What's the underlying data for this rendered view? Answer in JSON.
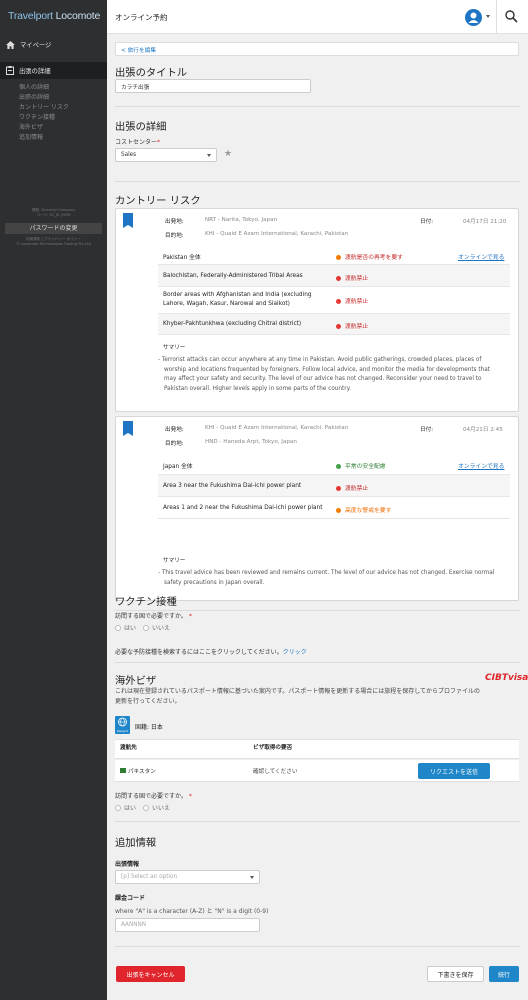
{
  "sidebar": {
    "logo_a": "Travelport",
    "logo_b": "Locomote",
    "home": "マイページ",
    "section": "出張の詳細",
    "subitems": [
      "個人の詳細",
      "出張の詳細",
      "カントリー リスク",
      "ワクチン接種",
      "海外ビザ",
      "追加情報"
    ],
    "footer_line1": "課程: Sincerity Company",
    "footer_line2": "コード: SC_JK_0099",
    "password_button": "パスワードの変更",
    "footer_line3": "利用規約 | プライバシー ポリシー",
    "footer_line4": "© Locomote Technologies Trading Pty Ltd"
  },
  "header": {
    "title": "オンライン予約"
  },
  "nav": {
    "back_link": "< 旅行を編集"
  },
  "trip_title": {
    "heading": "出張のタイトル",
    "value": "カラチ出張"
  },
  "trip_details": {
    "heading": "出張の詳細",
    "cost_center_label": "コストセンター",
    "required": "*",
    "cost_center_value": "Sales"
  },
  "country_risk": {
    "heading": "カントリー リスク",
    "labels": {
      "departure": "出発地:",
      "destination": "目的地:",
      "date": "日付:",
      "summary": "サマリー"
    },
    "segments": [
      {
        "departure": "NRT - Narita, Tokyo, Japan",
        "destination": "KHI - Quaid E Azam International, Karachi, Pakistan",
        "date": "04月17日 21:20",
        "rows": [
          {
            "name": "Pakistan 全体",
            "status": "渡航是否の再考を要す",
            "color": "#f57c00",
            "link": "オンラインで見る"
          },
          {
            "name": "Balochistan, Federally-Administered Tribal Areas",
            "status": "渡航禁止",
            "color": "#e53935",
            "link": ""
          },
          {
            "name": "Border areas with Afghanistan and India (excluding",
            "name2": "Lahore, Wagah, Kasur, Narowal and Sialkot)",
            "status": "渡航禁止",
            "color": "#e53935",
            "link": ""
          },
          {
            "name": "Khyber-Pakhtunkhwa (excluding Chitral district)",
            "status": "渡航禁止",
            "color": "#e53935",
            "link": ""
          }
        ],
        "summary_lines": [
          "- Terrorist attacks can occur anywhere at any time in Pakistan. Avoid public gatherings, crowded places, places of",
          "worship and locations frequented by foreigners. Follow local advice, and monitor the media for developments that",
          "may affect your safety and security. The level of our advice has not changed. Reconsider your need to travel to",
          "Pakistan overall. Higher levels apply in some parts of the country."
        ]
      },
      {
        "departure": "KHI - Quaid E Azam International, Karachi, Pakistan",
        "destination": "HND - Haneda Arpt, Tokyo, Japan",
        "date": "04月21日 2:45",
        "rows": [
          {
            "name": "Japan 全体",
            "status": "平常の安全配慮",
            "color": "#43a047",
            "link": "オンラインで見る"
          },
          {
            "name": "Area 3 near the Fukushima Dai-ichi power plant",
            "status": "渡航禁止",
            "color": "#e53935",
            "link": ""
          },
          {
            "name": "Areas 1 and 2 near the Fukushima Dai-ichi power plant",
            "status": "高度な警戒を要す",
            "color": "#f57c00",
            "link": ""
          }
        ],
        "summary_lines": [
          "- This travel advice has been reviewed and remains current. The level of our advice has not changed. Exercise normal",
          "safety precautions in Japan overall."
        ]
      }
    ]
  },
  "vaccination": {
    "heading": "ワクチン接種",
    "question": "訪問する国で必要ですか。",
    "required": "*",
    "yes": "はい",
    "no": "いいえ",
    "search_text": "必要な予防接種を検索するにはここをクリックしてください。",
    "search_link": "クリック"
  },
  "visa": {
    "heading": "海外ビザ",
    "brand": "CIBTvisas",
    "desc_line1": "これは現在登録されているパスポート情報に基づいた案内です。パスポート情報を更新する場合には旅程を保存してからプロファイルの",
    "desc_line2": "更新を行ってください。",
    "nationality_label": "国籍: 日本",
    "passport_caption": "Passport",
    "col_destination": "渡航先",
    "col_requirement": "ビザ取得の要否",
    "row_country": "パキスタン",
    "row_requirement": "確認してください",
    "request_button": "リクエストを送信",
    "question": "訪問する国で必要ですか。",
    "required": "*",
    "yes": "はい",
    "no": "いいえ"
  },
  "additional": {
    "heading": "追加情報",
    "trip_info_label": "出張情報",
    "trip_info_placeholder": "[p] Select an option",
    "billing_label": "課金コード",
    "billing_hint": "where \"A\" is a character (A-Z) と \"N\" is a digit (0-9)",
    "billing_placeholder": "AANNNN"
  },
  "footer": {
    "cancel": "出張をキャンセル",
    "save_draft": "下書きを保存",
    "continue": "続行"
  },
  "colors": {
    "accent": "#1f86c9",
    "danger": "#e0262c",
    "sidebar": "#2d2f31"
  }
}
